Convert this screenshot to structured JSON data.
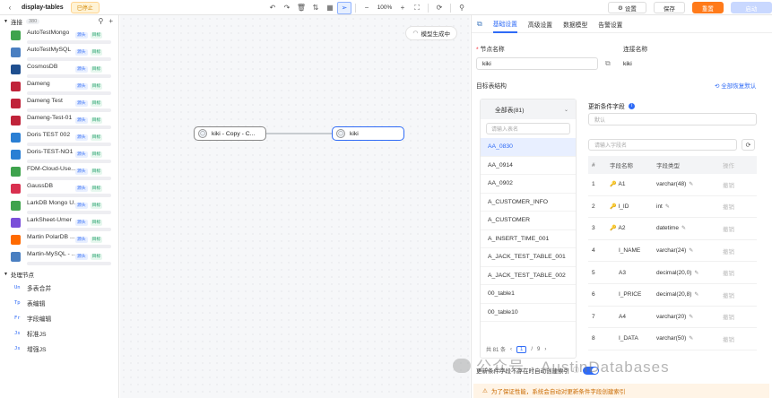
{
  "header": {
    "title": "display-tables",
    "status": "已停止",
    "zoom": "100%",
    "settings_label": "设置",
    "save_label": "保存",
    "reset_label": "重置",
    "start_label": "启动"
  },
  "sidebar": {
    "connections_label": "连接",
    "connections_count": "380",
    "tag_source": "源头",
    "tag_target": "目标",
    "connections": [
      {
        "name": "AutoTestMongo",
        "color": "#3fa34d"
      },
      {
        "name": "AutoTestMySQL",
        "color": "#4a7fc1"
      },
      {
        "name": "CosmosDB",
        "color": "#1f4f8f"
      },
      {
        "name": "Dameng",
        "color": "#c0233a"
      },
      {
        "name": "Dameng Test",
        "color": "#c0233a"
      },
      {
        "name": "Dameng-Test-01",
        "color": "#c0233a"
      },
      {
        "name": "Doris TEST 002",
        "color": "#2a7fd4"
      },
      {
        "name": "Doris-TEST-NO1",
        "color": "#2a7fd4"
      },
      {
        "name": "FDM-Cloud-Use...",
        "color": "#3fa34d"
      },
      {
        "name": "GaussDB",
        "color": "#d9304f"
      },
      {
        "name": "LarkDB Mongo U...",
        "color": "#3fa34d"
      },
      {
        "name": "LarkSheet-Umer",
        "color": "#7a4fd9"
      },
      {
        "name": "Martin PolarDB ...",
        "color": "#ff6a00"
      },
      {
        "name": "Martin-MySQL - ...",
        "color": "#4a7fc1"
      }
    ],
    "processors_label": "处理节点",
    "processors": [
      {
        "icon": "Un",
        "name": "多表合并"
      },
      {
        "icon": "Tp",
        "name": "表编辑"
      },
      {
        "icon": "Fr",
        "name": "字段编辑"
      },
      {
        "icon": "Js",
        "name": "标准JS"
      },
      {
        "icon": "Js",
        "name": "增强JS"
      }
    ]
  },
  "canvas": {
    "gen_label": "模型生成中",
    "source_node": "kiki - Copy - C...",
    "target_node": "kiki"
  },
  "panel": {
    "tabs": [
      "基础设置",
      "高级设置",
      "数据模型",
      "告警设置"
    ],
    "node_name_label": "节点名称",
    "node_name_value": "kiki",
    "conn_name_label": "连接名称",
    "conn_name_value": "kiki",
    "target_struct_label": "目标表结构",
    "restore_label": "全部恢复默认",
    "table_list_title": "全部表(81)",
    "table_search_placeholder": "请输入表名",
    "tables": [
      "AA_0830",
      "AA_0914",
      "AA_0902",
      "A_CUSTOMER_INFO",
      "A_CUSTOMER",
      "A_INSERT_TIME_001",
      "A_JACK_TEST_TABLE_001",
      "A_JACK_TEST_TABLE_002",
      "00_table1",
      "00_table10"
    ],
    "pager": {
      "total": "共 81 条",
      "current": "1",
      "pages": "9"
    },
    "update_fields_label": "更新条件字段",
    "update_placeholder": "默认",
    "field_search_placeholder": "请输入字段名",
    "field_headers": [
      "#",
      "字段名称",
      "字段类型",
      "操作"
    ],
    "fields": [
      {
        "idx": "1",
        "name": "A1",
        "type": "varchar(48)",
        "key": true,
        "op": "撤销"
      },
      {
        "idx": "2",
        "name": "I_ID",
        "type": "int",
        "key": true,
        "op": "撤销"
      },
      {
        "idx": "3",
        "name": "A2",
        "type": "datetime",
        "key": true,
        "op": "撤销"
      },
      {
        "idx": "4",
        "name": "I_NAME",
        "type": "varchar(24)",
        "key": false,
        "op": "撤销"
      },
      {
        "idx": "5",
        "name": "A3",
        "type": "decimal(20,0)",
        "key": false,
        "op": "撤销"
      },
      {
        "idx": "6",
        "name": "I_PRICE",
        "type": "decimal(20,8)",
        "key": false,
        "op": "撤销"
      },
      {
        "idx": "7",
        "name": "A4",
        "type": "varchar(20)",
        "key": false,
        "op": "撤销"
      },
      {
        "idx": "8",
        "name": "I_DATA",
        "type": "varchar(50)",
        "key": false,
        "op": "撤销"
      }
    ],
    "footer_option": "更新条件字段不存在时自动创建索引",
    "warning": "为了保证性能，系统会自动对更新条件字段创建索引"
  },
  "watermark": "公众号 · AustinDatabases"
}
